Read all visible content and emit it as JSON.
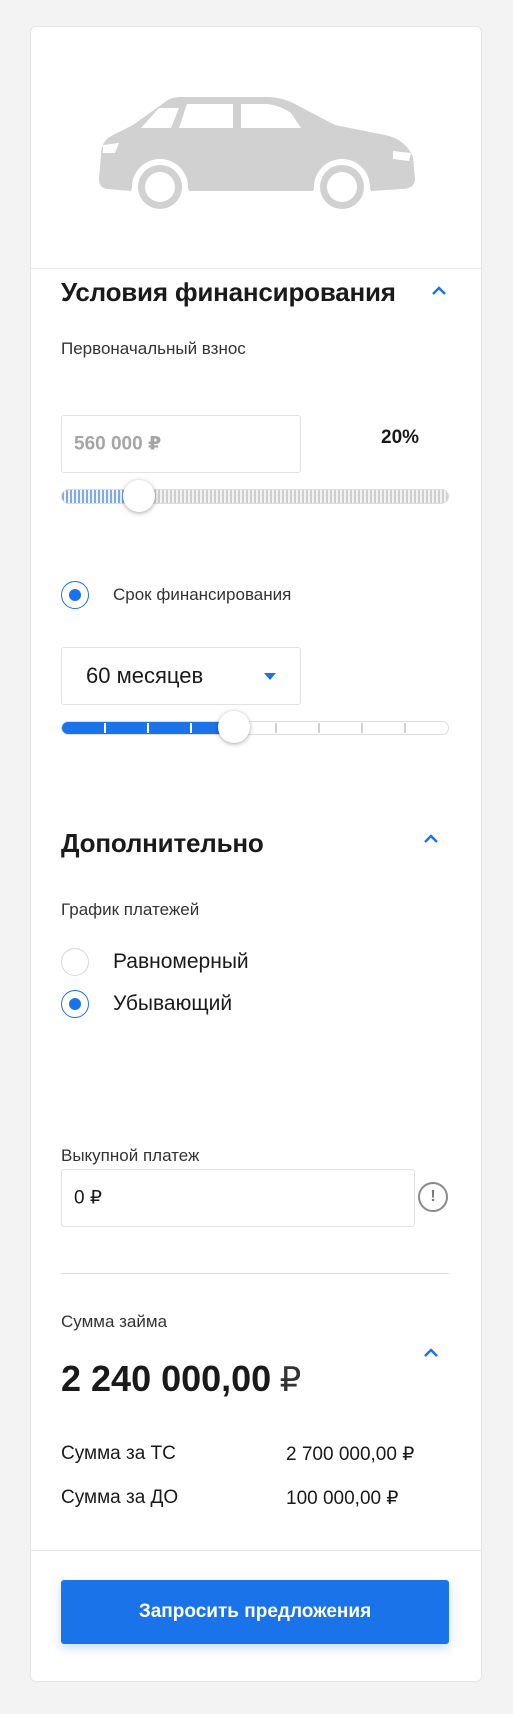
{
  "financing": {
    "title": "Условия финансирования",
    "down_payment_label": "Первоначальный взнос",
    "down_payment_value": "560 000 ₽",
    "down_payment_percent": "20%",
    "down_payment_fraction": 0.2,
    "term_label": "Срок финансирования",
    "term_value": "60 месяцев",
    "term_step": 4,
    "term_steps_total": 9
  },
  "additional": {
    "title": "Дополнительно",
    "schedule_label": "График платежей",
    "schedule_options": [
      {
        "label": "Равномерный",
        "selected": false
      },
      {
        "label": "Убывающий",
        "selected": true
      }
    ],
    "buyout_label": "Выкупной платеж",
    "buyout_value": "0 ₽"
  },
  "loan": {
    "label": "Сумма займа",
    "amount": "2 240 000,00",
    "currency": "₽",
    "rows": [
      {
        "label": "Сумма за ТС",
        "value": "2 700 000,00 ₽"
      },
      {
        "label": "Сумма за ДО",
        "value": "100 000,00 ₽"
      }
    ]
  },
  "submit_label": "Запросить предложения",
  "colors": {
    "accent": "#1a73e8",
    "car": "#d1d1d1"
  },
  "icons": {
    "collapse": "chevron-up-icon",
    "dropdown": "caret-down-icon",
    "info": "exclamation-circle-icon",
    "car": "car-silhouette-icon"
  }
}
